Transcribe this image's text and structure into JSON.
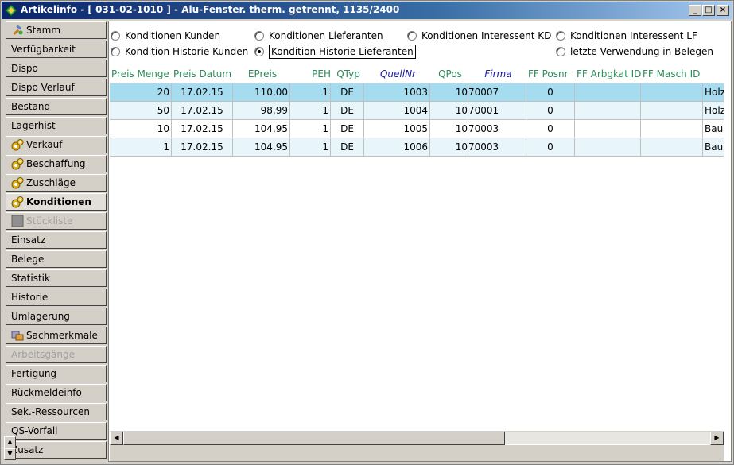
{
  "window": {
    "title": "Artikelinfo - [ 031-02-1010 ] - Alu-Fenster. therm. getrennt, 1135/2400",
    "buttons": {
      "minimize": "_",
      "maximize": "□",
      "close": "×"
    }
  },
  "sidebar": {
    "items": [
      {
        "label": "Stamm",
        "icon": "tools-icon"
      },
      {
        "label": "Verfügbarkeit"
      },
      {
        "label": "Dispo"
      },
      {
        "label": "Dispo Verlauf"
      },
      {
        "label": "Bestand"
      },
      {
        "label": "Lagerhist"
      },
      {
        "label": "Verkauf",
        "icon": "gears-icon"
      },
      {
        "label": "Beschaffung",
        "icon": "gears-icon"
      },
      {
        "label": "Zuschläge",
        "icon": "gears-icon"
      },
      {
        "label": "Konditionen",
        "icon": "gears-icon",
        "active": true
      },
      {
        "label": "Stückliste",
        "icon": "box-icon",
        "disabled": true
      },
      {
        "label": "Einsatz"
      },
      {
        "label": "Belege"
      },
      {
        "label": "Statistik"
      },
      {
        "label": "Historie"
      },
      {
        "label": "Umlagerung"
      },
      {
        "label": "Sachmerkmale",
        "icon": "features-icon"
      },
      {
        "label": "Arbeitsgänge",
        "disabled": true
      },
      {
        "label": "Fertigung"
      },
      {
        "label": "Rückmeldeinfo"
      },
      {
        "label": "Sek.-Ressourcen"
      },
      {
        "label": "QS-Vorfall"
      },
      {
        "label": "Zusatz"
      }
    ]
  },
  "options": {
    "radios": [
      {
        "label": "Konditionen Kunden",
        "checked": false
      },
      {
        "label": "Konditionen Lieferanten",
        "checked": false
      },
      {
        "label": "Konditionen Interessent KD",
        "checked": false
      },
      {
        "label": "Konditionen Interessent LF",
        "checked": false
      },
      {
        "label": "Kondition Historie Kunden",
        "checked": false
      },
      {
        "label": "Kondition Historie Lieferanten",
        "checked": true
      },
      {
        "label": "letzte Verwendung in Belegen",
        "checked": false
      }
    ]
  },
  "table": {
    "columns": [
      "Preis Menge",
      "Preis Datum",
      "EPreis",
      "PEH",
      "QTyp",
      "QuellNr",
      "QPos",
      "Firma",
      "FF Posnr",
      "FF Arbgkat ID",
      "FF Masch ID"
    ],
    "rows": [
      [
        "20",
        "17.02.15",
        "110,00",
        "1",
        "DE",
        "1003",
        "10",
        "70007",
        "0",
        "",
        "",
        "Holz"
      ],
      [
        "50",
        "17.02.15",
        "98,99",
        "1",
        "DE",
        "1004",
        "10",
        "70001",
        "0",
        "",
        "",
        "Holz"
      ],
      [
        "10",
        "17.02.15",
        "104,95",
        "1",
        "DE",
        "1005",
        "10",
        "70003",
        "0",
        "",
        "",
        "Bau"
      ],
      [
        "1",
        "17.02.15",
        "104,95",
        "1",
        "DE",
        "1006",
        "10",
        "70003",
        "0",
        "",
        "",
        "Bau"
      ]
    ],
    "selected_row": 0
  },
  "colors": {
    "header_text": "#2e8b57",
    "header_italic_text": "#1a1aa0",
    "selected_row": "#a6dcef",
    "alt_row": "#e8f6fc"
  }
}
